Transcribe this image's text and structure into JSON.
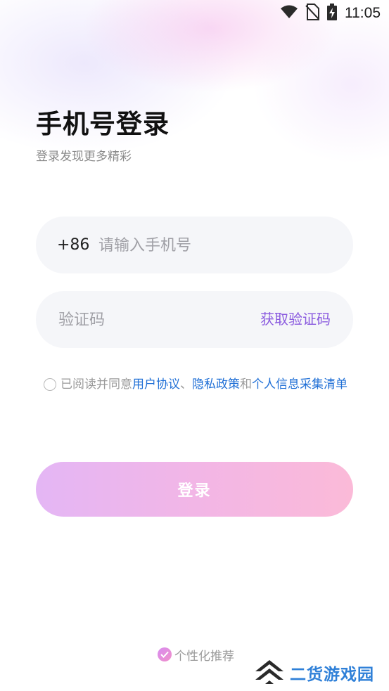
{
  "status_bar": {
    "time": "11:05",
    "icons": [
      "wifi-icon",
      "no-sim-icon",
      "battery-charging-icon"
    ]
  },
  "header": {
    "title": "手机号登录",
    "subtitle": "登录发现更多精彩"
  },
  "phone_field": {
    "country_code": "+86",
    "value": "",
    "placeholder": "请输入手机号"
  },
  "code_field": {
    "value": "",
    "placeholder": "验证码",
    "get_code_label": "获取验证码"
  },
  "agreement": {
    "checked": false,
    "prefix": "已阅读并同意",
    "user_agreement": "用户协议",
    "separator": "、",
    "privacy_policy": "隐私政策",
    "conjunction": "和",
    "personal_info_list": "个人信息采集清单"
  },
  "login_button": {
    "label": "登录"
  },
  "personalized": {
    "checked": true,
    "label": "个性化推荐"
  },
  "watermark": {
    "text": "二货游戏园"
  },
  "colors": {
    "accent_purple": "#8a5adf",
    "link_blue": "#1f6fd6",
    "button_gradient_start": "#e4b6f5",
    "button_gradient_end": "#fbbad8"
  }
}
